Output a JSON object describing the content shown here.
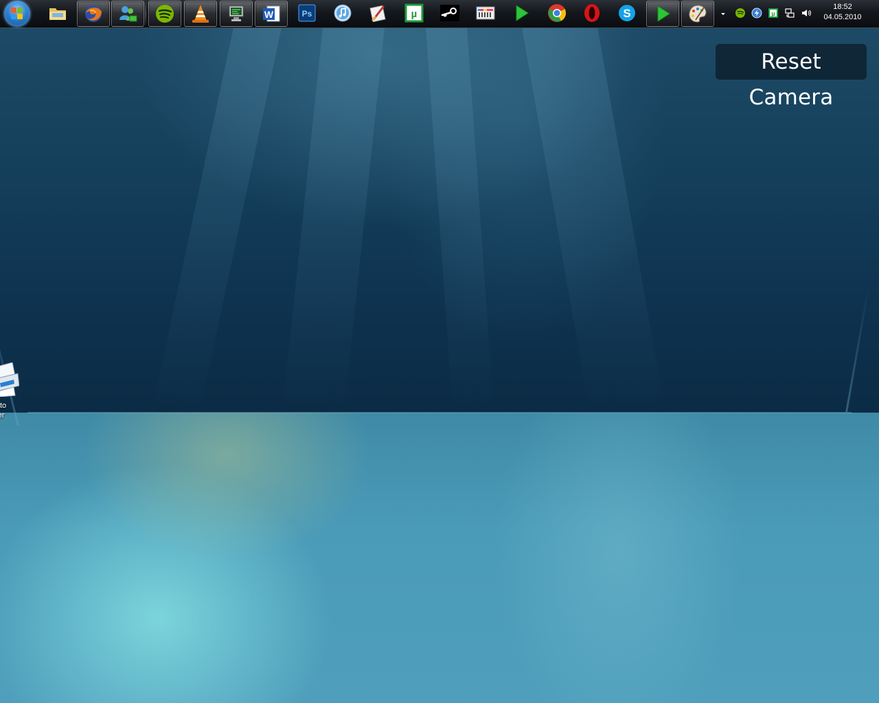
{
  "taskbar": {
    "start_button": {
      "icon": "windows-logo-icon"
    },
    "pinned": [
      {
        "name": "windows-explorer",
        "icon": "folder-icon",
        "active": false
      },
      {
        "name": "firefox",
        "icon": "firefox-icon",
        "active": true
      },
      {
        "name": "windows-live-messenger",
        "icon": "messenger-icon",
        "active": true
      },
      {
        "name": "spotify",
        "icon": "spotify-icon",
        "active": true
      },
      {
        "name": "vlc",
        "icon": "vlc-cone-icon",
        "active": true
      },
      {
        "name": "remote-desktop",
        "icon": "monitor-icon",
        "active": true
      },
      {
        "name": "word",
        "icon": "word-icon",
        "active": true
      },
      {
        "name": "photoshop",
        "icon": "photoshop-icon",
        "active": false
      },
      {
        "name": "itunes",
        "icon": "itunes-icon",
        "active": false
      },
      {
        "name": "paint-tool",
        "icon": "brush-icon",
        "active": false
      },
      {
        "name": "utorrent",
        "icon": "utorrent-icon",
        "active": false
      },
      {
        "name": "steam",
        "icon": "steam-icon",
        "active": false
      },
      {
        "name": "equalizer",
        "icon": "equalizer-icon",
        "active": false
      },
      {
        "name": "media-player",
        "icon": "play-icon",
        "active": false
      },
      {
        "name": "chrome",
        "icon": "chrome-icon",
        "active": false
      },
      {
        "name": "opera",
        "icon": "opera-icon",
        "active": false
      },
      {
        "name": "skype",
        "icon": "skype-icon",
        "active": false
      },
      {
        "name": "media-player-2",
        "icon": "play-icon",
        "active": true
      },
      {
        "name": "paint",
        "icon": "palette-icon",
        "active": true
      }
    ],
    "tray": {
      "icons": [
        "show-hidden-icons-arrow-icon",
        "spotify-icon",
        "power-icon",
        "utorrent-icon",
        "network-icon",
        "volume-icon"
      ],
      "time": "18:52",
      "date": "04.05.2010"
    }
  },
  "overlay": {
    "reset_camera_label": "Reset Camera"
  },
  "desktop": {
    "icons": [
      {
        "icon": "printer-icon",
        "label": "d to\nter"
      }
    ]
  },
  "colors": {
    "wall": "#15405c",
    "floor": "#4a9bb8",
    "taskbar": "#14171c",
    "reset_bg": "#0c1e2a"
  }
}
